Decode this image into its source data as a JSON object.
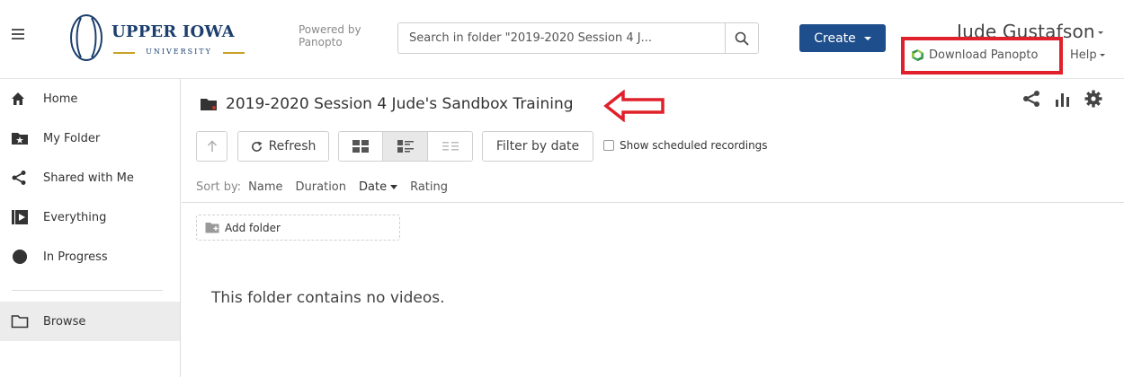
{
  "header": {
    "logo_main": "UPPER IOWA",
    "logo_sub": "UNIVERSITY",
    "powered_by": "Powered by Panopto",
    "search_placeholder": "Search in folder \"2019-2020 Session 4 J...",
    "create_label": "Create",
    "user_name": "Jude Gustafson",
    "download_label": "Download Panopto",
    "help_label": "Help"
  },
  "sidebar": {
    "items": [
      {
        "label": "Home",
        "icon": "home-icon"
      },
      {
        "label": "My Folder",
        "icon": "my-folder-icon"
      },
      {
        "label": "Shared with Me",
        "icon": "share-icon"
      },
      {
        "label": "Everything",
        "icon": "play-icon"
      },
      {
        "label": "In Progress",
        "icon": "progress-icon"
      },
      {
        "label": "Browse",
        "icon": "folder-outline-icon"
      }
    ]
  },
  "main": {
    "folder_title": "2019-2020 Session 4 Jude's Sandbox Training",
    "refresh_label": "Refresh",
    "filter_label": "Filter by date",
    "show_scheduled_label": "Show scheduled recordings",
    "sort": {
      "label": "Sort by:",
      "options": [
        "Name",
        "Duration",
        "Date",
        "Rating"
      ],
      "selected": "Date"
    },
    "add_folder_label": "Add folder",
    "empty_message": "This folder contains no videos."
  },
  "colors": {
    "accent": "#1f4e8c",
    "annotation": "#e0202a",
    "brand_gold": "#c9a227"
  }
}
